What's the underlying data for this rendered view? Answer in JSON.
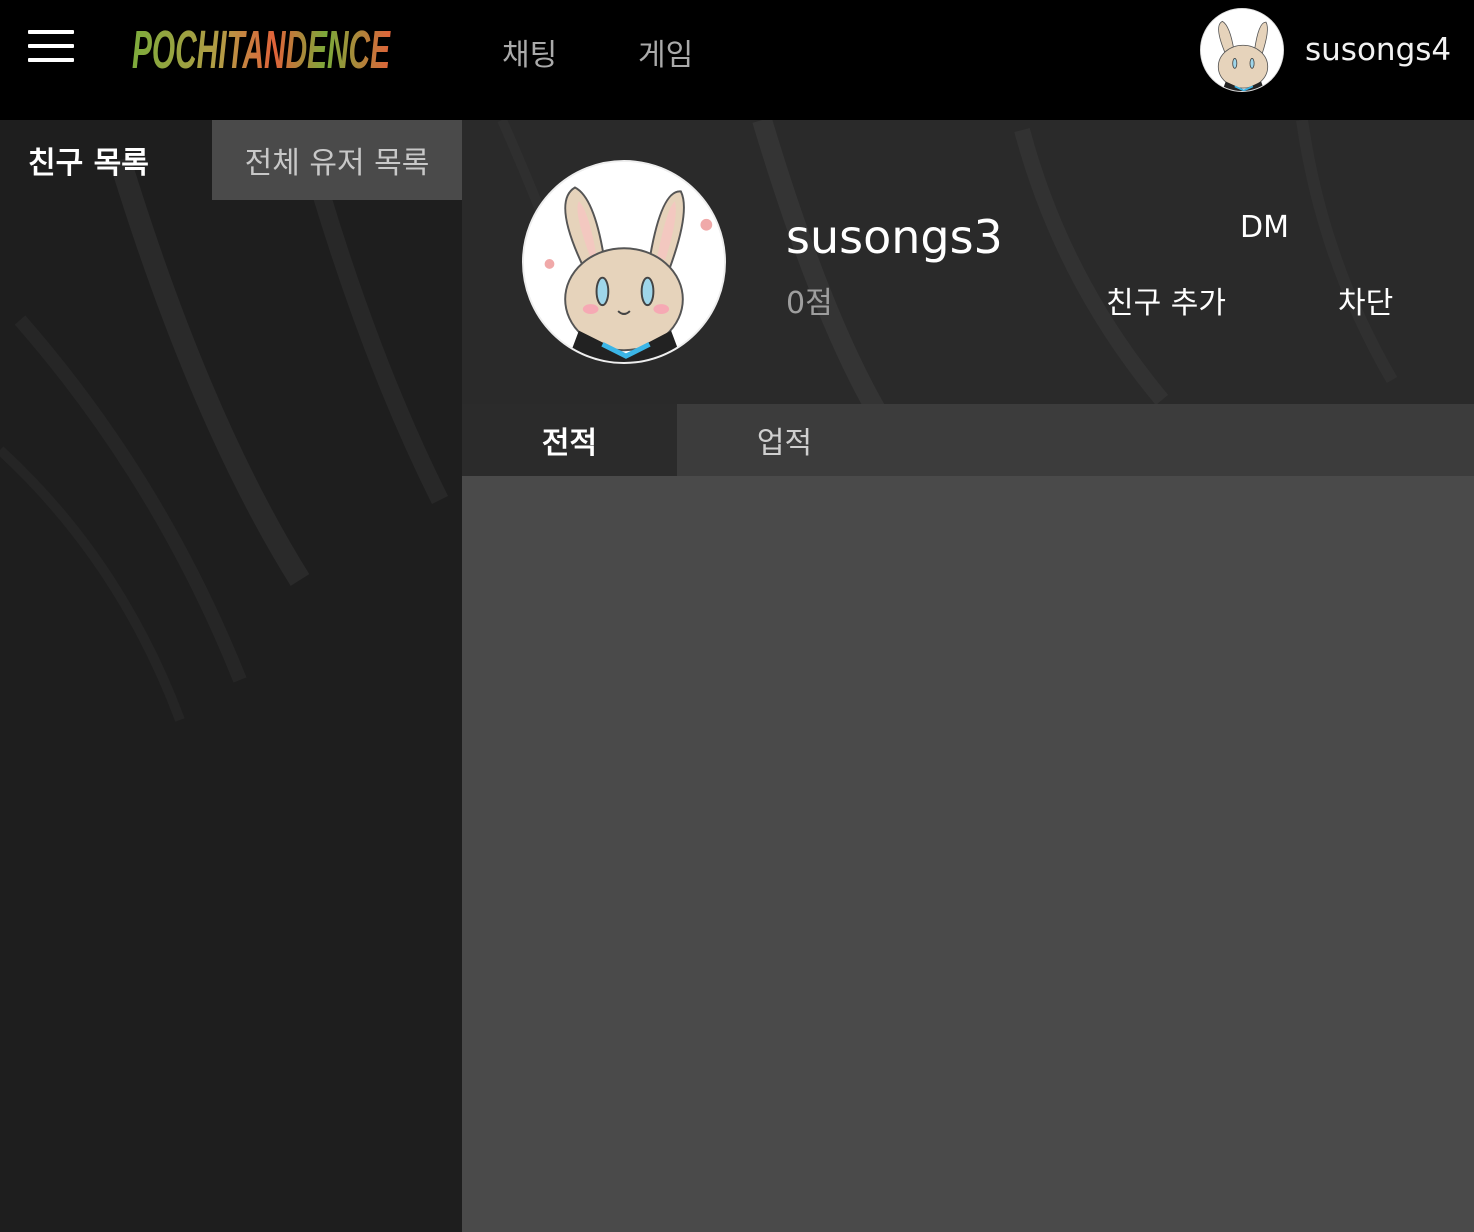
{
  "header": {
    "logo_text": "POCHITANDENCE",
    "nav": [
      {
        "label": "채팅"
      },
      {
        "label": "게임"
      }
    ],
    "current_user": "susongs4"
  },
  "sidebar": {
    "tabs": [
      {
        "label": "친구 목록",
        "active": true
      },
      {
        "label": "전체 유저 목록",
        "active": false
      }
    ]
  },
  "profile": {
    "username": "susongs3",
    "score": "0점",
    "actions": {
      "dm": "DM",
      "add_friend": "친구 추가",
      "block": "차단"
    }
  },
  "tabs": [
    {
      "label": "전적",
      "active": true
    },
    {
      "label": "업적",
      "active": false
    }
  ],
  "colors": {
    "topbar": "#000000",
    "sidebar": "#1e1e1e",
    "main": "#2a2a2a",
    "content": "#4a4a4a",
    "logo_green": "#7dab3c",
    "logo_orange": "#e0633a"
  }
}
